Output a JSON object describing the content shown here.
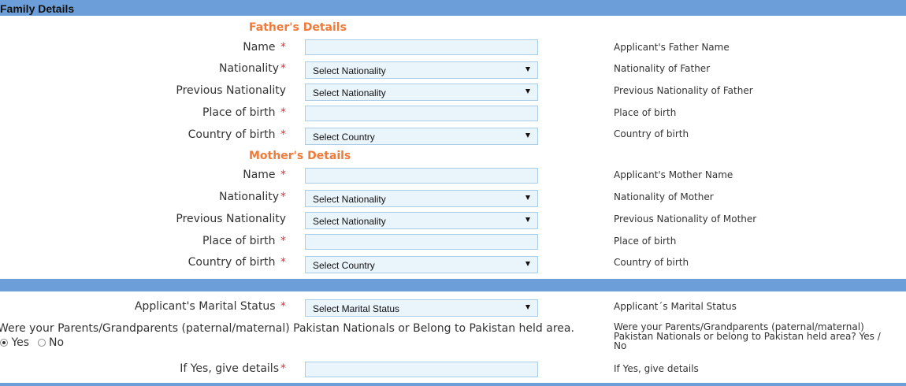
{
  "header": {
    "title": "Family Details"
  },
  "father": {
    "section_title": "Father's Details",
    "name_label": "Name",
    "name_value": "",
    "name_help": "Applicant's Father Name",
    "nationality_label": "Nationality",
    "nationality_value": "Select Nationality",
    "nationality_help": "Nationality of Father",
    "prev_nationality_label": "Previous Nationality",
    "prev_nationality_value": "Select Nationality",
    "prev_nationality_help": "Previous Nationality of Father",
    "pob_label": "Place of birth",
    "pob_value": "",
    "pob_help": "Place of birth",
    "cob_label": "Country of birth",
    "cob_value": "Select Country",
    "cob_help": "Country of birth"
  },
  "mother": {
    "section_title": "Mother's Details",
    "name_label": "Name",
    "name_value": "",
    "name_help": "Applicant's Mother Name",
    "nationality_label": "Nationality",
    "nationality_value": "Select Nationality",
    "nationality_help": "Nationality of Mother",
    "prev_nationality_label": "Previous Nationality",
    "prev_nationality_value": "Select Nationality",
    "prev_nationality_help": "Previous Nationality of Mother",
    "pob_label": "Place of birth",
    "pob_value": "",
    "pob_help": "Place of birth",
    "cob_label": "Country of birth",
    "cob_value": "Select Country",
    "cob_help": "Country of birth"
  },
  "marital": {
    "label": "Applicant's Marital Status",
    "value": "Select Marital Status",
    "help": "Applicant´s Marital Status"
  },
  "pakistan": {
    "question": "Were your Parents/Grandparents (paternal/maternal) Pakistan Nationals or Belong to Pakistan held area.",
    "yes_label": "Yes",
    "no_label": "No",
    "selected": "Yes",
    "help": "Were your Parents/Grandparents (paternal/maternal) Pakistan Nationals or belong to Pakistan held area? Yes / No"
  },
  "details": {
    "label": "If Yes, give details",
    "value": "",
    "help": "If Yes, give details"
  },
  "required_mark": "*",
  "colors": {
    "header_bar": "#6c9fd9",
    "section_title": "#f07a3a",
    "required": "#d9333b",
    "field_bg": "#eaf4fb",
    "field_border": "#a9cde6"
  }
}
